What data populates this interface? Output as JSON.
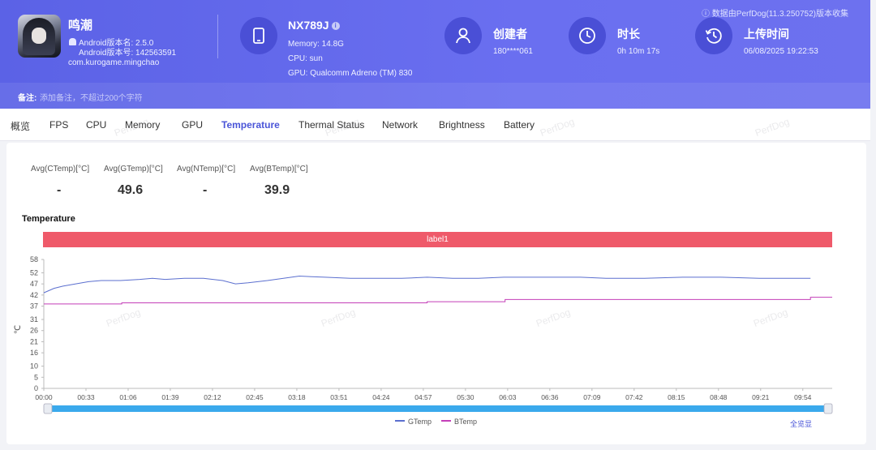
{
  "header": {
    "data_note": "数据由PerfDog(11.3.250752)版本收集",
    "app": {
      "name": "鸣潮",
      "version_name": "Android版本名: 2.5.0",
      "version_code": "Android版本号: 142563591",
      "package": "com.kurogame.mingchao"
    },
    "device": {
      "title": "NX789J",
      "memory": "Memory: 14.8G",
      "cpu": "CPU: sun",
      "gpu": "GPU: Qualcomm Adreno (TM) 830"
    },
    "creator": {
      "title": "创建者",
      "value": "180****061"
    },
    "duration": {
      "title": "时长",
      "value": "0h 10m 17s"
    },
    "upload": {
      "title": "上传时间",
      "value": "06/08/2025 19:22:53"
    },
    "remark": {
      "label": "备注:",
      "placeholder": "添加备注，不超过200个字符"
    }
  },
  "tabs": [
    "概览",
    "FPS",
    "CPU",
    "Memory",
    "GPU",
    "Temperature",
    "Thermal Status",
    "Network",
    "Brightness",
    "Battery"
  ],
  "active_tab": "Temperature",
  "stats": [
    {
      "label": "Avg(CTemp)[°C]",
      "value": "-"
    },
    {
      "label": "Avg(GTemp)[°C]",
      "value": "49.6"
    },
    {
      "label": "Avg(NTemp)[°C]",
      "value": "-"
    },
    {
      "label": "Avg(BTemp)[°C]",
      "value": "39.9"
    }
  ],
  "chart_data": {
    "type": "line",
    "title": "Temperature",
    "band_label": "label1",
    "ylabel": "℃",
    "ylim": [
      0,
      58
    ],
    "y_ticks": [
      "58",
      "52",
      "47",
      "42",
      "37",
      "31",
      "26",
      "21",
      "16",
      "10",
      "5",
      "0"
    ],
    "x_ticks": [
      "00:00",
      "00:33",
      "01:06",
      "01:39",
      "02:12",
      "02:45",
      "03:18",
      "03:51",
      "04:24",
      "04:57",
      "05:30",
      "06:03",
      "06:36",
      "07:09",
      "07:42",
      "08:15",
      "08:48",
      "09:21",
      "09:54"
    ],
    "x_range_seconds": [
      0,
      617
    ],
    "series": [
      {
        "name": "GTemp",
        "color": "#5b6fcf",
        "x_seconds": [
          0,
          8,
          15,
          25,
          35,
          45,
          60,
          75,
          85,
          95,
          110,
          125,
          140,
          150,
          160,
          175,
          200,
          220,
          240,
          260,
          280,
          300,
          320,
          340,
          360,
          380,
          400,
          420,
          440,
          470,
          500,
          530,
          560,
          600
        ],
        "values": [
          43,
          45,
          46,
          47,
          48,
          48.5,
          48.5,
          49,
          49.5,
          49,
          49.5,
          49.5,
          48.5,
          47,
          47.5,
          48.5,
          50.5,
          50,
          49.5,
          49.5,
          49.5,
          50,
          49.5,
          49.5,
          50,
          50,
          50,
          50,
          49.5,
          49.5,
          50,
          50,
          49.5,
          49.5
        ]
      },
      {
        "name": "BTemp",
        "color": "#c43fb8",
        "x_seconds": [
          0,
          60,
          61,
          120,
          180,
          240,
          300,
          360,
          361,
          420,
          480,
          540,
          600,
          617
        ],
        "values": [
          38,
          38,
          38.5,
          38.5,
          38.5,
          38.5,
          39,
          39,
          40,
          40,
          40,
          40,
          41,
          41
        ]
      }
    ]
  },
  "all_view": "全览显",
  "watermark": "PerfDog"
}
